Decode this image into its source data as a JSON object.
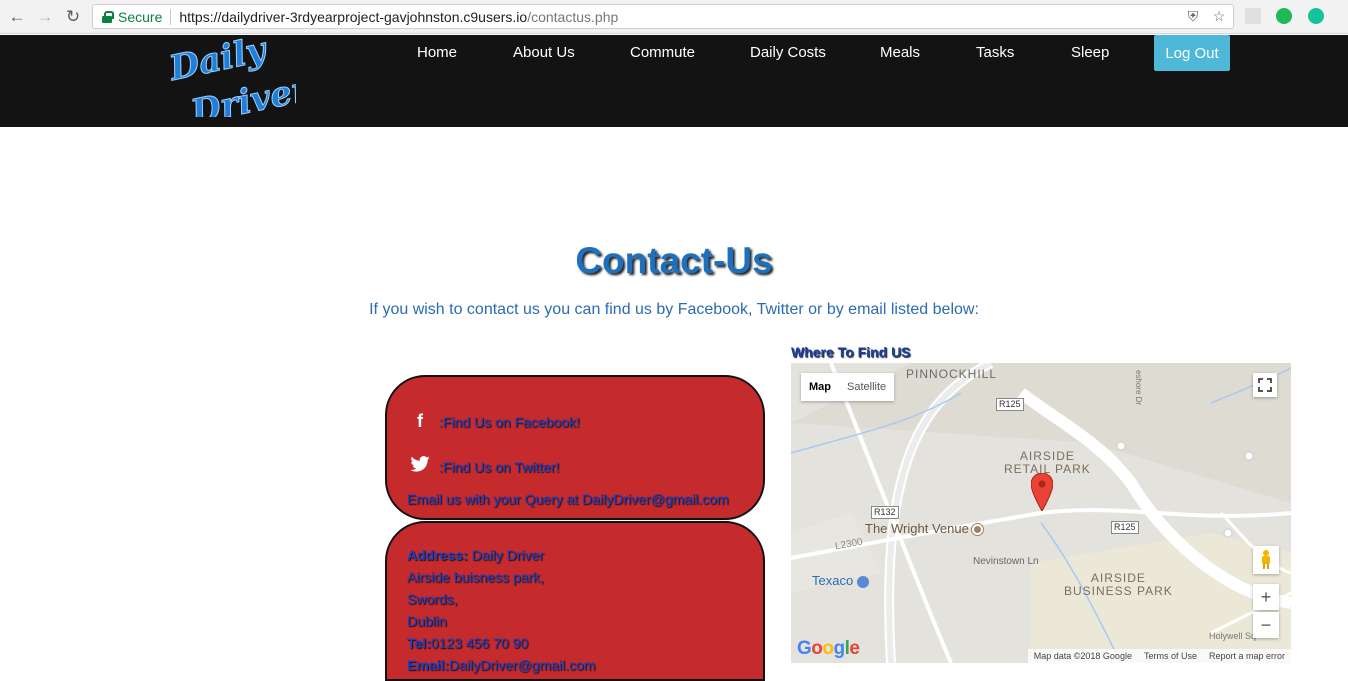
{
  "browser": {
    "secure_label": "Secure",
    "url_host": "https://dailydriver-3rdyearproject-gavjohnston.c9users.io",
    "url_path": "/contactus.php"
  },
  "header": {
    "logo_line1": "Daily",
    "logo_line2": "Driver",
    "nav": [
      "Home",
      "About Us",
      "Commute",
      "Daily Costs",
      "Meals",
      "Tasks",
      "Sleep"
    ],
    "logout_label": "Log Out"
  },
  "main": {
    "title": "Contact-Us",
    "intro": "If you wish to contact us you can find us by Facebook, Twitter or by email listed below:",
    "social": {
      "facebook": ":Find Us on Facebook!",
      "twitter": ":Find Us on Twitter!",
      "email_line": "Email us with your Query at DailyDriver@gmail.com"
    },
    "address": {
      "address_label": "Address:",
      "name": " Daily Driver",
      "line2": "Airside buisness park,",
      "line3": "Swords,",
      "line4": "Dublin",
      "tel_label": "Tel:",
      "tel": "0123 456 70 90",
      "email_label": "Email:",
      "email": "DailyDriver@gmail.com"
    }
  },
  "map": {
    "title": "Where To Find US",
    "type_map": "Map",
    "type_satellite": "Satellite",
    "labels": {
      "pinnockhill": "PINNOCKHILL",
      "airside_retail_1": "AIRSIDE",
      "airside_retail_2": "RETAIL PARK",
      "wright_venue": "The Wright Venue",
      "texaco": "Texaco",
      "nevinstown": "Nevinstown Ln",
      "airside_business_1": "AIRSIDE",
      "airside_business_2": "BUSINESS PARK",
      "holywell": "Holywell Sq",
      "l2300": "L2300",
      "r125a": "R125",
      "r125b": "R125",
      "r132": "R132",
      "shore": "eshore Dr"
    },
    "footer": {
      "data": "Map data ©2018 Google",
      "terms": "Terms of Use",
      "report": "Report a map error"
    },
    "google_logo": "Google"
  }
}
